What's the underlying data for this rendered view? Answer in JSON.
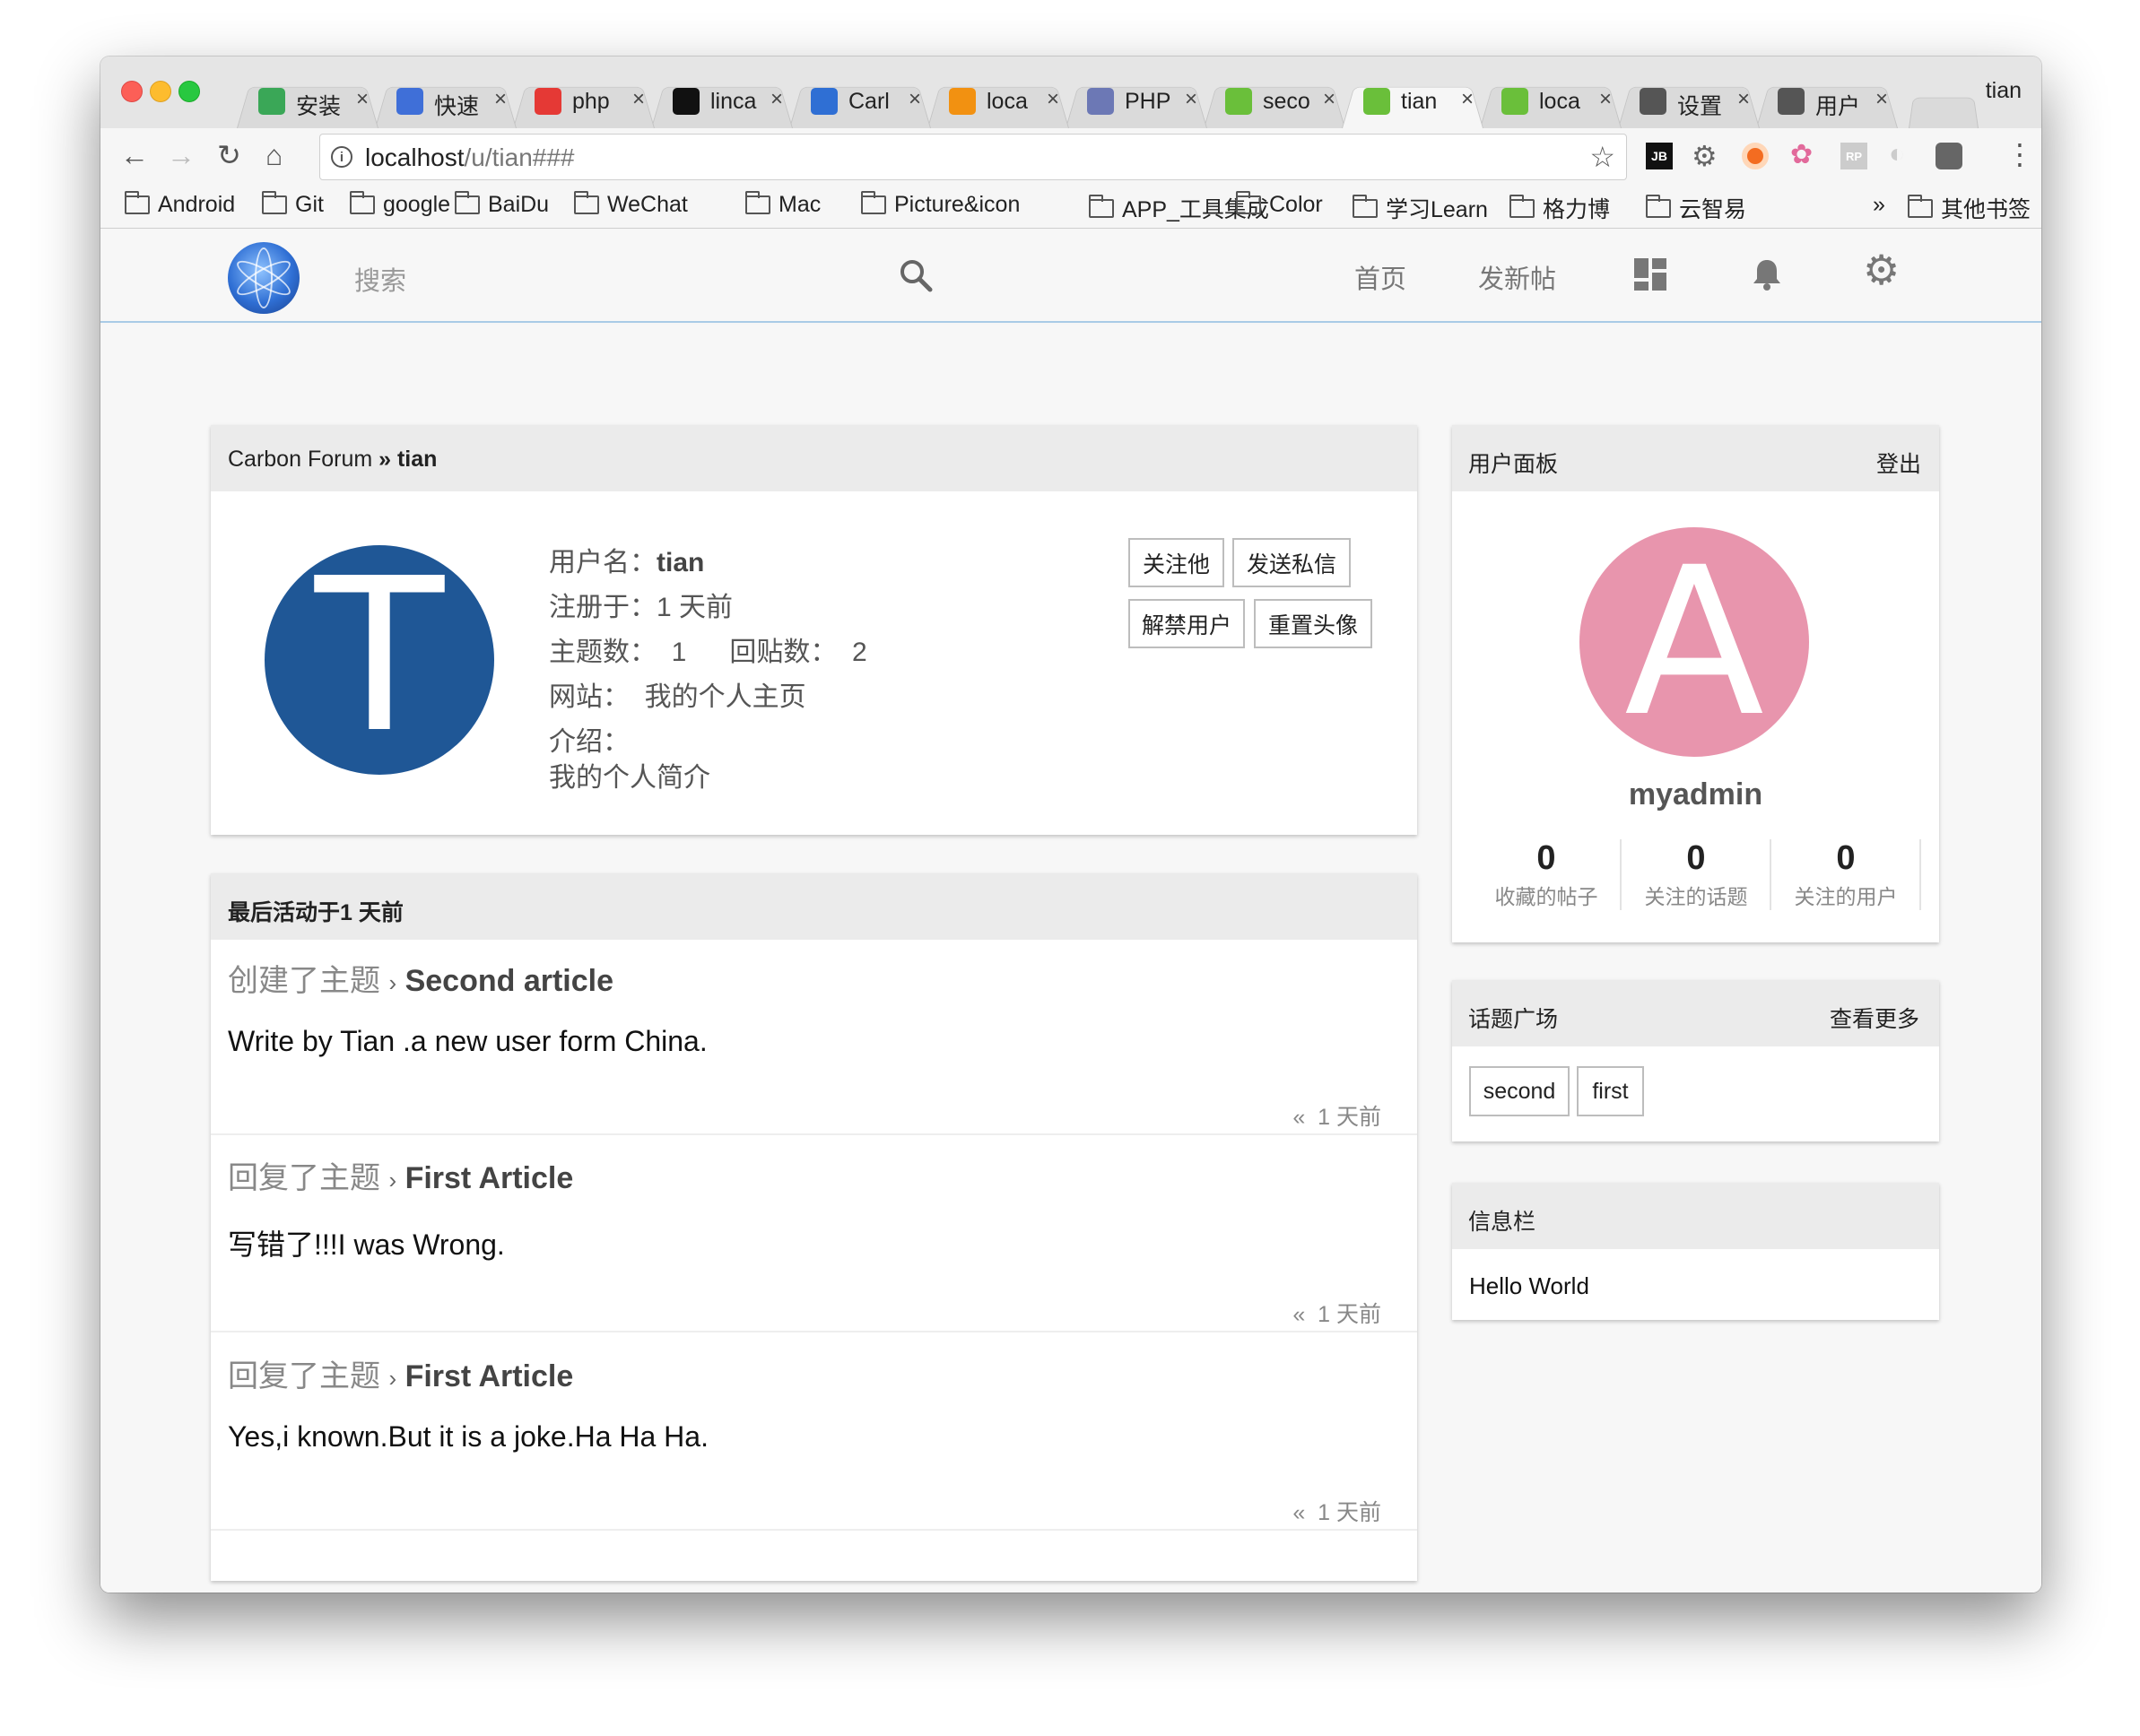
{
  "browser": {
    "profile_name": "tian",
    "tabs": [
      {
        "label": "安装",
        "icon": "cloud-icon",
        "color": "#3aa757"
      },
      {
        "label": "快速",
        "icon": "shield-icon",
        "color": "#3f6fd8"
      },
      {
        "label": "php",
        "icon": "g-logo-icon",
        "color": "#e53935"
      },
      {
        "label": "linca",
        "icon": "github-icon",
        "color": "#111111"
      },
      {
        "label": "Carl",
        "icon": "carbon-icon",
        "color": "#2f6fd4"
      },
      {
        "label": "loca",
        "icon": "phpmyadmin-icon",
        "color": "#f29111"
      },
      {
        "label": "PHP",
        "icon": "php-icon",
        "color": "#6c78b5"
      },
      {
        "label": "seco",
        "icon": "leaf-icon",
        "color": "#6abf3a"
      },
      {
        "label": "tian",
        "icon": "leaf-icon",
        "color": "#6abf3a"
      },
      {
        "label": "loca",
        "icon": "leaf-icon",
        "color": "#6abf3a"
      },
      {
        "label": "设置",
        "icon": "gear-icon",
        "color": "#555555"
      },
      {
        "label": "用户",
        "icon": "book-icon",
        "color": "#555555"
      }
    ],
    "active_tab_index": 8,
    "url_host": "localhost",
    "url_path": "/u/tian###",
    "bookmarks": [
      "Android",
      "Git",
      "google",
      "BaiDu",
      "WeChat",
      "Mac",
      "Picture&icon",
      "APP_工具集成",
      "Color",
      "学习Learn",
      "格力博",
      "云智易"
    ],
    "bookmarks_overflow": "»",
    "other_bookmarks": "其他书签"
  },
  "nav": {
    "search_placeholder": "搜索",
    "home": "首页",
    "new_post": "发新帖"
  },
  "profile_card": {
    "breadcrumb_site": "Carbon Forum",
    "breadcrumb_sep": "»",
    "breadcrumb_user": "tian",
    "avatar_letter": "T",
    "avatar_color": "#1f5796",
    "username_label": "用户名：",
    "username": "tian",
    "registered_label": "注册于：",
    "registered": "1 天前",
    "topics_label": "主题数：",
    "topics": "1",
    "replies_label": "回贴数：",
    "replies": "2",
    "website_label": "网站：",
    "website": "我的个人主页",
    "intro_label": "介绍：",
    "intro": "我的个人简介",
    "buttons": {
      "follow": "关注他",
      "message": "发送私信",
      "unban": "解禁用户",
      "reset_avatar": "重置头像"
    }
  },
  "activity": {
    "header": "最后活动于1 天前",
    "items": [
      {
        "action": "创建了主题",
        "title": "Second article",
        "body": "Write by Tian .a new user form China.",
        "time": "1 天前"
      },
      {
        "action": "回复了主题",
        "title": "First Article",
        "body": "写错了!!!I was Wrong.",
        "time": "1 天前"
      },
      {
        "action": "回复了主题",
        "title": "First Article",
        "body": "Yes,i known.But it is a joke.Ha Ha Ha.",
        "time": "1 天前"
      }
    ],
    "time_prefix": "«"
  },
  "user_panel": {
    "title": "用户面板",
    "logout": "登出",
    "avatar_letter": "A",
    "avatar_color": "#e895ad",
    "username": "myadmin",
    "stats": [
      {
        "value": "0",
        "label": "收藏的帖子"
      },
      {
        "value": "0",
        "label": "关注的话题"
      },
      {
        "value": "0",
        "label": "关注的用户"
      }
    ]
  },
  "topics_panel": {
    "title": "话题广场",
    "more": "查看更多",
    "tags": [
      "second",
      "first"
    ]
  },
  "info_panel": {
    "title": "信息栏",
    "text": "Hello World"
  }
}
